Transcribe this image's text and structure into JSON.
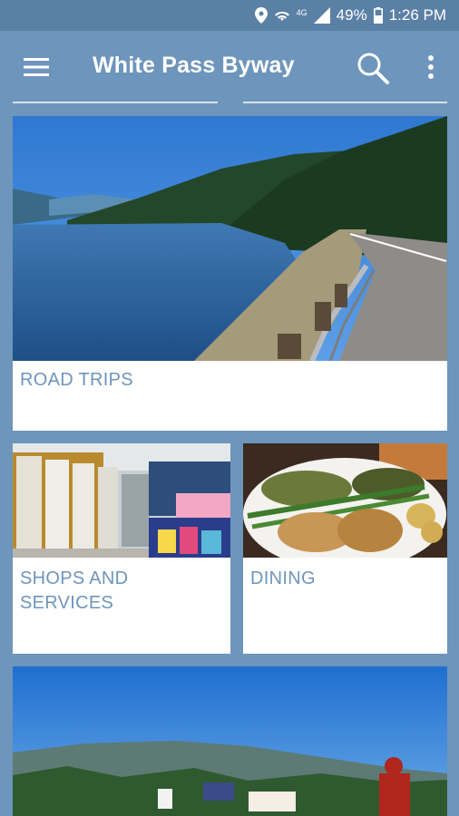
{
  "status_bar": {
    "icons": [
      "location-icon",
      "wifi-icon",
      "lte-icon",
      "signal-icon",
      "battery-icon"
    ],
    "lte": "4G",
    "battery": "49%",
    "time": "1:26 PM"
  },
  "app_bar": {
    "title": "White Pass Byway",
    "icons": [
      "menu-icon",
      "search-icon",
      "more-vert-icon"
    ]
  },
  "cards": [
    {
      "label": "ROAD TRIPS",
      "photo": "lake-highway-photo"
    },
    {
      "label": "SHOPS AND SERVICES",
      "photo": "store-interior-photo"
    },
    {
      "label": "DINING",
      "photo": "dinner-plate-photo"
    },
    {
      "label": "",
      "photo": "mountain-town-photo"
    }
  ],
  "colors": {
    "background": "#6e95bb",
    "status_bar": "#5b80a6",
    "label_text": "#6e95bb",
    "card": "#ffffff"
  }
}
